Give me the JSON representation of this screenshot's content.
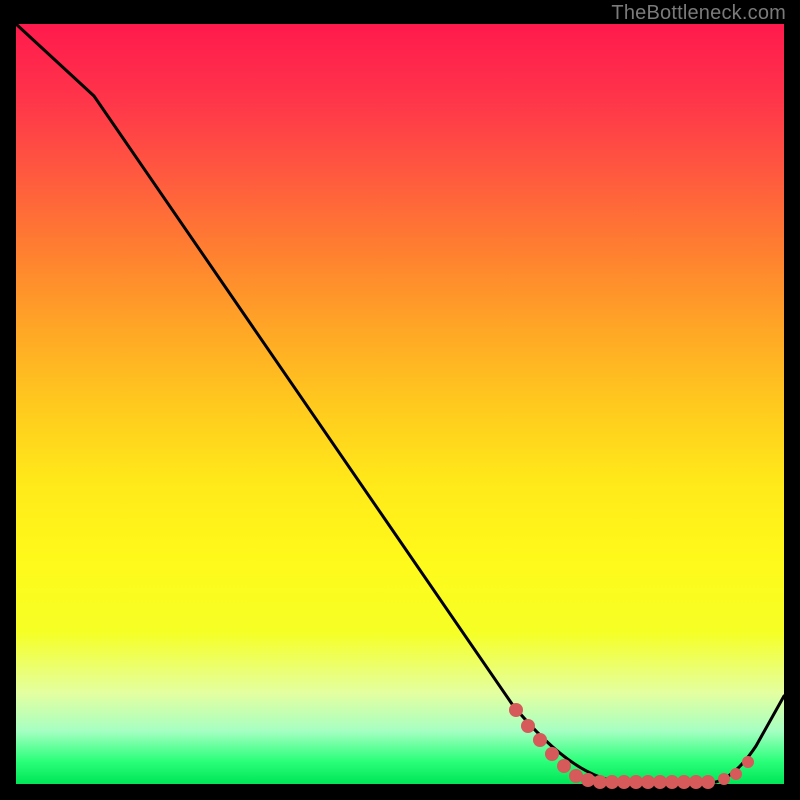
{
  "watermark": "TheBottleneck.com",
  "chart_data": {
    "type": "line",
    "title": "",
    "xlabel": "",
    "ylabel": "",
    "xlim": [
      0,
      100
    ],
    "ylim": [
      0,
      100
    ],
    "series": [
      {
        "name": "bottleneck-curve",
        "x": [
          0,
          10,
          60,
          78,
          88,
          100
        ],
        "y": [
          100,
          90,
          20,
          0,
          0,
          15
        ]
      }
    ],
    "highlight_region": {
      "x_start": 78,
      "x_end": 92
    },
    "colors": {
      "curve": "#000000",
      "highlight": "#d65a5a",
      "gradient_top": "#ff1a4d",
      "gradient_bottom": "#00e557"
    }
  }
}
